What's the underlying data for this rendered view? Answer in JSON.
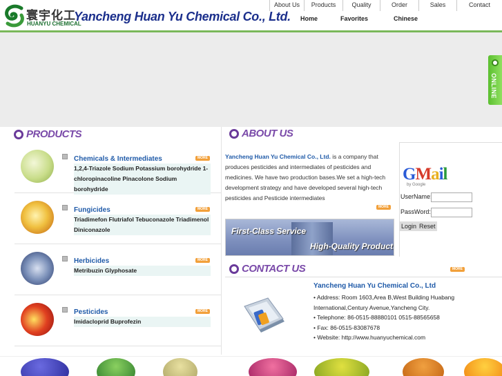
{
  "header": {
    "logo_cn": "寰宇化工",
    "logo_en": "HUANYU CHEMICAL",
    "company_name": "Yancheng Huan Yu Chemical Co., Ltd.",
    "top_nav": [
      "About Us",
      "Products",
      "Quality",
      "Order",
      "Sales",
      "Contact"
    ],
    "sub_nav": [
      "Home",
      "Favorites",
      "Chinese"
    ]
  },
  "online_button": {
    "label": "ONLINE"
  },
  "products": {
    "title": "PRODUCTS",
    "more_label": "MORE",
    "categories": [
      {
        "title": "Chemicals & Intermediates",
        "items": "1,2,4-Triazole Sodium  Potassium borohydride  1-chloropinacoline  Pinacolone  Sodium borohydride"
      },
      {
        "title": "Fungicides",
        "items": "Triadimefon  Flutriafol  Tebuconazole  Triadimenol  Diniconazole"
      },
      {
        "title": "Herbicides",
        "items": "Metribuzin  Glyphosate"
      },
      {
        "title": "Pesticides",
        "items": "Imidacloprid  Buprofezin"
      }
    ]
  },
  "about": {
    "title": "ABOUT US",
    "company": "Yancheng Huan Yu Chemical Co., Ltd.",
    "text": " is a company that produces pesticides and intermediates of pesticides and medicines. We have two production bases.We set a high-tech development strategy and have developed several high-tech pesticides and Pesticide intermediates",
    "more_label": "MORE",
    "banner_line1": "First-Class Service",
    "banner_line2": "High-Quality Products"
  },
  "login": {
    "gmail_logo": "Gmail",
    "gmail_sub": "by Google",
    "username_label": "UserName:",
    "password_label": "PassWord:",
    "login_button": "Login",
    "reset_button": "Reset"
  },
  "contact": {
    "title": "CONTACT US",
    "more_label": "MORE",
    "company": "Yancheng Huan Yu Chemical Co., Ltd",
    "address": "• Address: Room 1603,Area B,West Building Huabang International,Century Avenue,Yancheng City.",
    "telephone": "• Telephone: 86-0515-88880101 0515-88565658",
    "fax": "• Fax: 86-0515-83087678",
    "website": "• Website: http://www.huanyuchemical.com"
  },
  "colors": {
    "accent_green": "#7ab85a",
    "link_blue": "#1f5aa8",
    "section_purple": "#7a4aa9",
    "more_orange": "#f2a03a"
  }
}
